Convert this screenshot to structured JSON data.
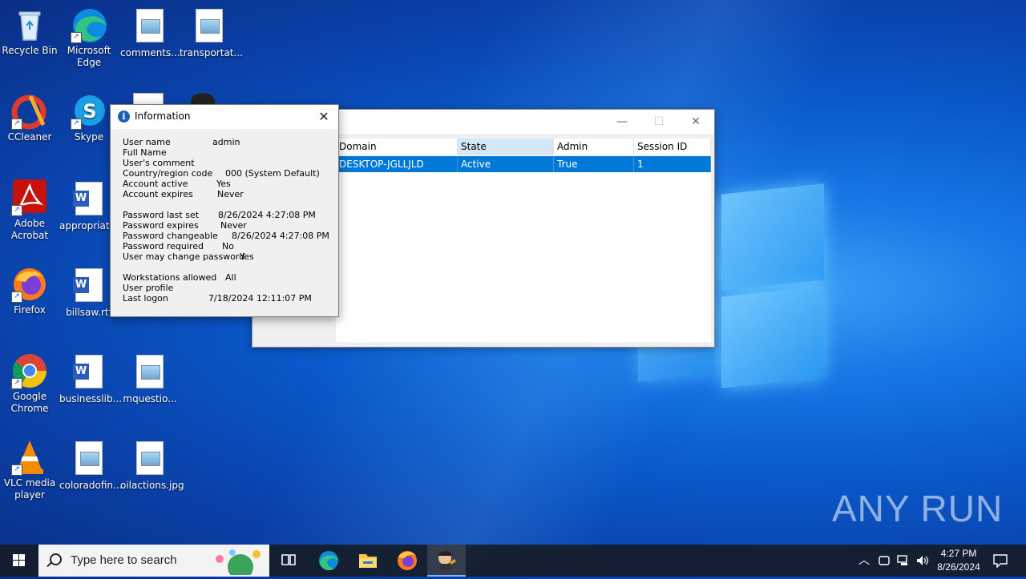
{
  "desktop": {
    "icons": [
      {
        "label": "Recycle Bin"
      },
      {
        "label": "Microsoft Edge"
      },
      {
        "label": "comments..."
      },
      {
        "label": "transportat..."
      },
      {
        "label": "CCleaner"
      },
      {
        "label": "Skype"
      },
      {
        "label": "Adobe Acrobat"
      },
      {
        "label": "appropriat..."
      },
      {
        "label": "Firefox"
      },
      {
        "label": "billsaw.rtf"
      },
      {
        "label": "Google Chrome"
      },
      {
        "label": "businesslib..."
      },
      {
        "label": "mquestio..."
      },
      {
        "label": "VLC media player"
      },
      {
        "label": "coloradofin..."
      },
      {
        "label": "oilactions.jpg"
      }
    ]
  },
  "sessions_window": {
    "columns": [
      "Domain",
      "State",
      "Admin",
      "Session ID"
    ],
    "rows": [
      [
        "DESKTOP-JGLLJLD",
        "Active",
        "True",
        "1"
      ]
    ],
    "minimize_glyph": "—",
    "maximize_glyph": "☐",
    "close_glyph": "✕"
  },
  "info_dialog": {
    "title": "Information",
    "close_glyph": "✕",
    "fields": [
      {
        "key": "User name",
        "value": "admin"
      },
      {
        "key": "Full Name",
        "value": ""
      },
      {
        "key": "User's comment",
        "value": ""
      },
      {
        "key": "Country/region code",
        "value": "000 (System Default)"
      },
      {
        "key": "Account active",
        "value": "Yes"
      },
      {
        "key": "Account expires",
        "value": "Never"
      },
      {
        "key": "Password last set",
        "value": "8/26/2024 4:27:08 PM"
      },
      {
        "key": "Password expires",
        "value": "Never"
      },
      {
        "key": "Password changeable",
        "value": "8/26/2024 4:27:08 PM"
      },
      {
        "key": "Password required",
        "value": "No"
      },
      {
        "key": "User may change password",
        "value": "Yes"
      },
      {
        "key": "Workstations allowed",
        "value": "All"
      },
      {
        "key": "User profile",
        "value": ""
      },
      {
        "key": "Last logon",
        "value": "7/18/2024 12:11:07 PM"
      }
    ]
  },
  "taskbar": {
    "search_placeholder": "Type here to search",
    "apps": [
      "task-view",
      "edge",
      "file-explorer",
      "firefox",
      "running-app"
    ],
    "time": "4:27 PM",
    "date": "8/26/2024"
  },
  "watermark": "ANY RUN",
  "colors": {
    "selection": "#0078d7",
    "taskbar": "#161c28",
    "desktop_accent": "#1677e6"
  }
}
